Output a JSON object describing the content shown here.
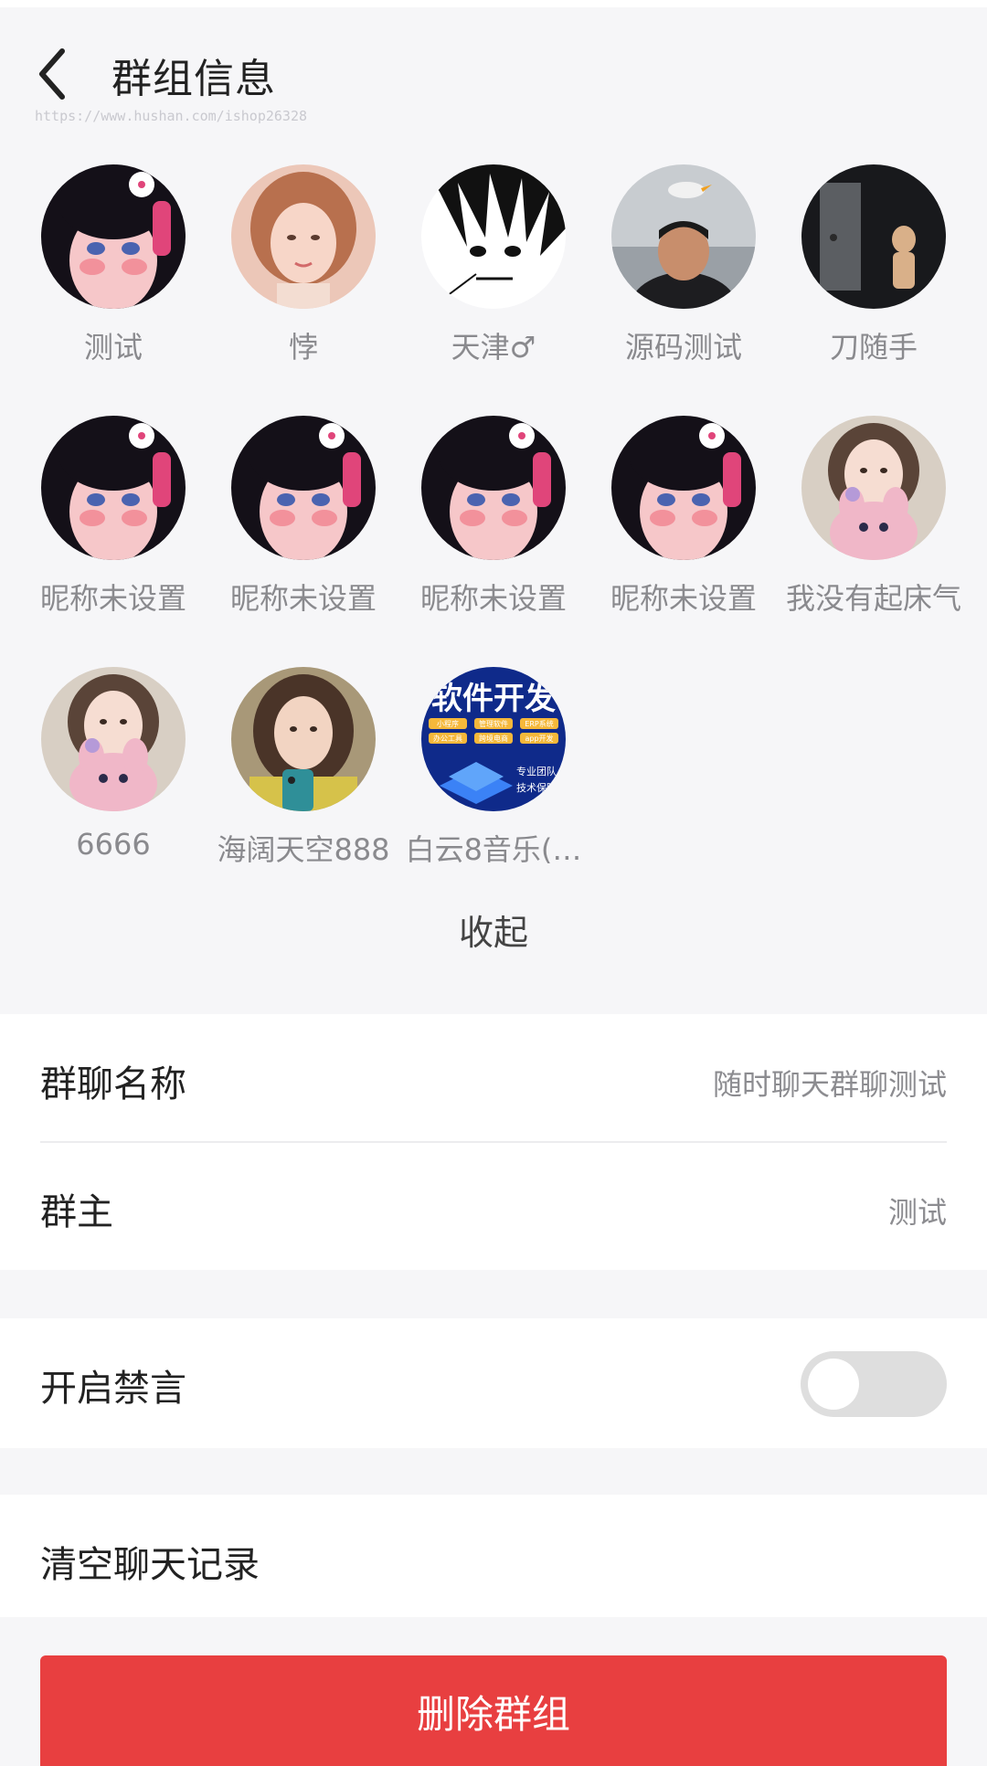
{
  "header": {
    "title": "群组信息",
    "watermark": "https://www.hushan.com/ishop26328"
  },
  "members": [
    {
      "name": "测试",
      "avatar": "anime-girl-avatar"
    },
    {
      "name": "悖",
      "avatar": "woman-short-hair-avatar"
    },
    {
      "name": "天津♂",
      "avatar": "manga-boy-avatar"
    },
    {
      "name": "源码测试",
      "avatar": "man-seagull-avatar"
    },
    {
      "name": "刀随手",
      "avatar": "dark-figure-avatar"
    },
    {
      "name": "昵称未设置",
      "avatar": "anime-girl-avatar"
    },
    {
      "name": "昵称未设置",
      "avatar": "anime-girl-avatar"
    },
    {
      "name": "昵称未设置",
      "avatar": "anime-girl-avatar"
    },
    {
      "name": "昵称未设置",
      "avatar": "anime-girl-avatar"
    },
    {
      "name": "我没有起床气",
      "avatar": "girl-plush-avatar"
    },
    {
      "name": "6666",
      "avatar": "girl-plush-avatar"
    },
    {
      "name": "海阔天空888",
      "avatar": "girl-phone-avatar"
    },
    {
      "name": "白云8音乐(…",
      "avatar": "software-ad-avatar"
    }
  ],
  "software_ad": {
    "headline": "软件开发",
    "tags": [
      "小程序",
      "管理软件",
      "ERP系统",
      "办公工具",
      "跨境电商",
      "app开发"
    ],
    "bullets": [
      "专业团队",
      "技术保障"
    ]
  },
  "collapse_label": "收起",
  "group_name": {
    "label": "群聊名称",
    "value": "随时聊天群聊测试"
  },
  "group_owner": {
    "label": "群主",
    "value": "测试"
  },
  "mute_all": {
    "label": "开启禁言",
    "enabled": false
  },
  "clear_history": {
    "label": "清空聊天记录"
  },
  "delete_group": {
    "label": "删除群组"
  },
  "colors": {
    "accent_red": "#e83f40",
    "background": "#f6f6f8",
    "toggle_off": "#dedede"
  }
}
